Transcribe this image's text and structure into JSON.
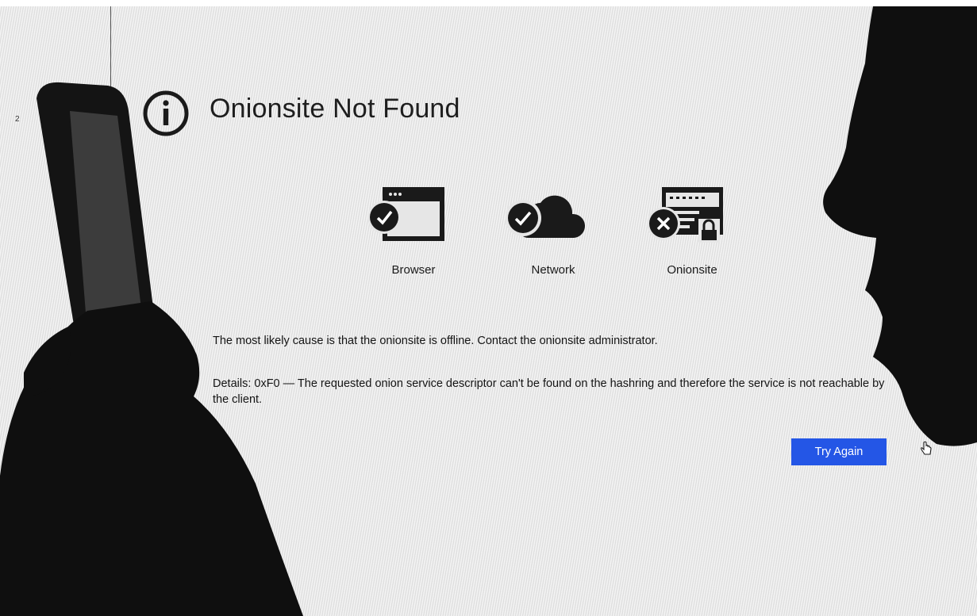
{
  "sidebar": {
    "number": "2"
  },
  "title": "Onionsite Not Found",
  "diagnostics": [
    {
      "label": "Browser",
      "status": "ok",
      "icon": "browser-window-icon"
    },
    {
      "label": "Network",
      "status": "ok",
      "icon": "cloud-icon"
    },
    {
      "label": "Onionsite",
      "status": "error",
      "icon": "server-lock-icon"
    }
  ],
  "message": {
    "cause": "The most likely cause is that the onionsite is offline. Contact the onionsite administrator.",
    "details": "Details: 0xF0 — The requested onion service descriptor can't be found on the hashring and therefore the service is not reachable by the client."
  },
  "actions": {
    "try_again": "Try Again"
  },
  "colors": {
    "button": "#2456e6",
    "icon": "#1a1a1a",
    "background": "#e6e6e6"
  }
}
